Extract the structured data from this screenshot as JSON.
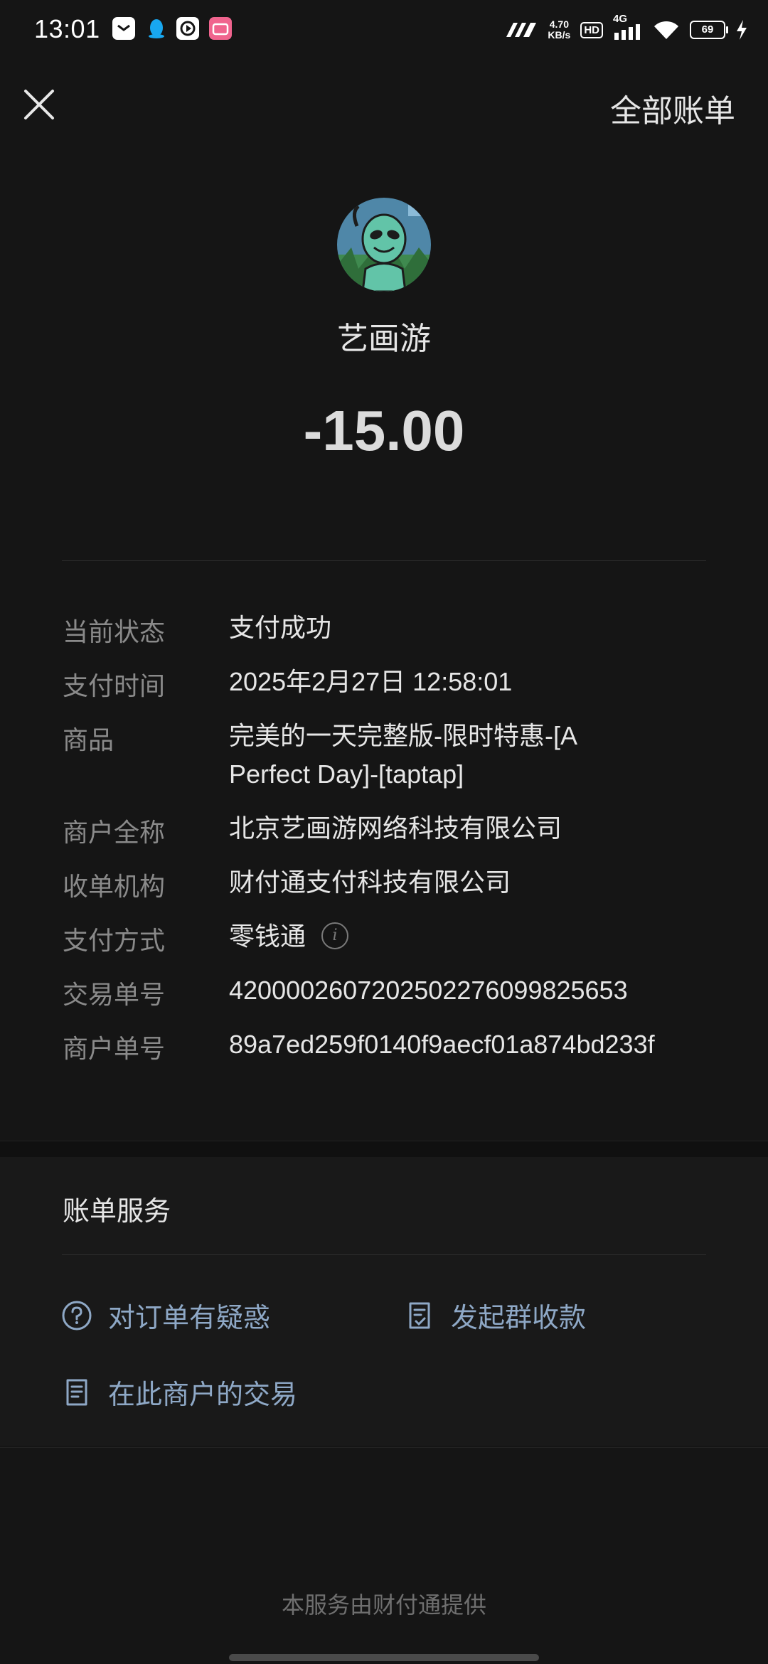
{
  "status_bar": {
    "time": "13:01",
    "net_speed_value": "4.70",
    "net_speed_unit": "KB/s",
    "hd": "HD",
    "network": "4G",
    "battery": "69",
    "icons": [
      "message-icon",
      "qq-penguin-icon",
      "video-player-icon",
      "bilibili-icon",
      "signal-icon",
      "wifi-icon",
      "charging-icon"
    ]
  },
  "header": {
    "close_icon": "close-icon",
    "all_bills_label": "全部账单"
  },
  "merchant": {
    "avatar": "alien-avatar",
    "name": "艺画游",
    "amount": "-15.00"
  },
  "details": [
    {
      "label": "当前状态",
      "value": "支付成功"
    },
    {
      "label": "支付时间",
      "value": "2025年2月27日 12:58:01"
    },
    {
      "label": "商品",
      "value": "完美的一天完整版-限时特惠-[A Perfect Day]-[taptap]"
    },
    {
      "label": "商户全称",
      "value": "北京艺画游网络科技有限公司"
    },
    {
      "label": "收单机构",
      "value": "财付通支付科技有限公司"
    },
    {
      "label": "支付方式",
      "value": "零钱通"
    },
    {
      "label": "交易单号",
      "value": "4200002607202502276099825653"
    },
    {
      "label": "商户单号",
      "value": "89a7ed259f0140f9aecf01a874bd233f"
    }
  ],
  "services": {
    "title": "账单服务",
    "items": [
      {
        "label": "对订单有疑惑",
        "icon": "question-circle-icon"
      },
      {
        "label": "发起群收款",
        "icon": "receipt-check-icon"
      },
      {
        "label": "在此商户的交易",
        "icon": "document-list-icon"
      }
    ]
  },
  "footer": {
    "text": "本服务由财付通提供"
  },
  "colors": {
    "background": "#151515",
    "link_blue": "#8ea8c6",
    "label_gray": "#8a8a8a"
  }
}
